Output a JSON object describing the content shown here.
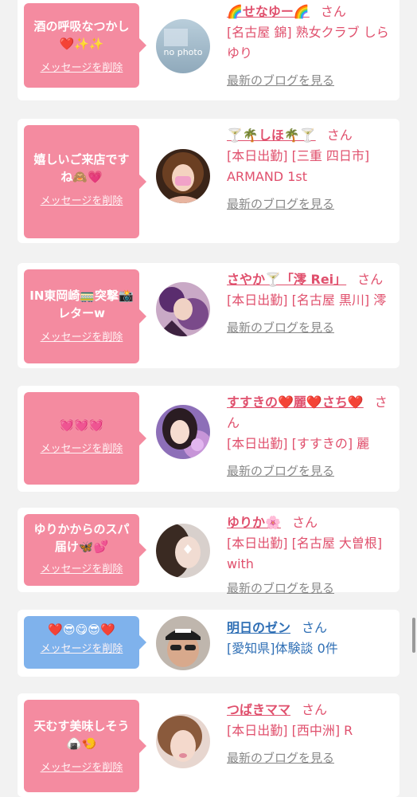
{
  "common": {
    "delete_label": "メッセージを削除",
    "blog_label": "最新のブログを見る"
  },
  "colors": {
    "pink_bubble": "#f48ba0",
    "blue_bubble": "#7fb2ec",
    "pink_text": "#e0506d",
    "blue_text": "#2f6fb5"
  },
  "items": [
    {
      "message": "酒の呼吸なつかし❤️✨✨",
      "bubble": "pink",
      "avatar": "no photo",
      "name": "🌈せなゆー🌈",
      "honorific": "さん",
      "details": "[名古屋 錦] 熟女クラブ しらゆり"
    },
    {
      "message": "嬉しいご来店ですね🙈💗",
      "bubble": "pink",
      "avatar": "",
      "name": "🍸🌴しほ🌴🍸",
      "honorific": "さん",
      "details": "[本日出勤] [三重 四日市] ARMAND 1st"
    },
    {
      "message": "IN東岡崎🚃突撃📸レターw",
      "bubble": "pink",
      "avatar": "",
      "name": "さやか🍸「澪 Rei」",
      "honorific": "さん",
      "details": "[本日出勤] [名古屋 黒川] 澪"
    },
    {
      "message": "💓💓💓",
      "bubble": "pink",
      "avatar": "",
      "name": "すすきの❤️麗❤️さち❤️",
      "honorific": "さん",
      "details": "[本日出勤] [すすきの] 麗"
    },
    {
      "message": "ゆりかからのスパ届け🦋💕",
      "bubble": "pink",
      "avatar": "",
      "name": "ゆりか🌸",
      "honorific": "さん",
      "details": "[本日出勤] [名古屋 大曽根] with"
    },
    {
      "message": "❤️😎😋😎❤️",
      "bubble": "blue",
      "avatar": "",
      "name": "明日のゼン",
      "honorific": "さん",
      "details": "[愛知県]体験談 0件"
    },
    {
      "message": "天むす美味しそう🍙🍤",
      "bubble": "pink",
      "avatar": "",
      "name": "つばきママ",
      "honorific": "さん",
      "details": "[本日出勤] [西中洲] R"
    }
  ]
}
